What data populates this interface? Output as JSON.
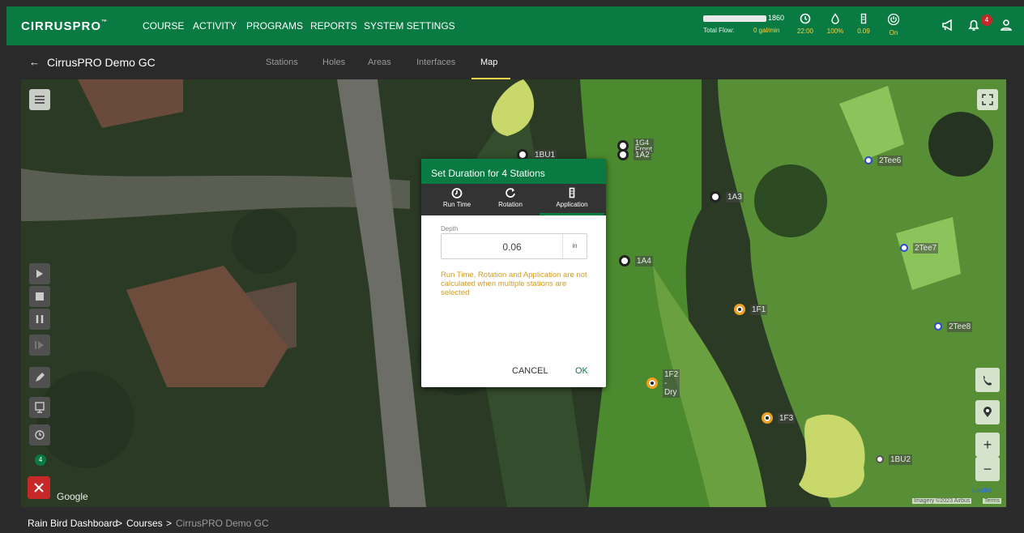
{
  "topbar": {
    "logo": "CIRRUSPRO",
    "logo_tm": "™",
    "nav": [
      "COURSE",
      "ACTIVITY",
      "PROGRAMS",
      "REPORTS",
      "SYSTEM SETTINGS"
    ],
    "flow": {
      "number": "1860",
      "label": "Total Flow:",
      "value": "0 gal/min"
    },
    "stats": [
      {
        "icon": "clock-icon",
        "value": "22:00"
      },
      {
        "icon": "water-drop-icon",
        "value": "100%"
      },
      {
        "icon": "rain-gauge-icon",
        "value": "0.09"
      },
      {
        "icon": "power-icon",
        "value": "On"
      }
    ],
    "notification_count": "4"
  },
  "subbar": {
    "back": "←",
    "title": "CirrusPRO Demo GC",
    "tabs": [
      "Stations",
      "Holes",
      "Areas",
      "Interfaces",
      "Map"
    ],
    "active_tab": "Map"
  },
  "map": {
    "selected_count": "4",
    "zoom_in": "+",
    "zoom_out": "−",
    "google": "Google",
    "leaflet": "Leaflet",
    "imagery": "Imagery ©2023 Airbus",
    "terms": "Terms",
    "stations": [
      "1BU1",
      "1G4",
      "Front",
      "1A2",
      "1A3",
      "1A4",
      "1F1",
      "1F2",
      "-",
      "Dry",
      "1F3",
      "2Tee6",
      "2Tee7",
      "2Tee8",
      "1BU2"
    ]
  },
  "dialog": {
    "title": "Set Duration for 4 Stations",
    "tabs": [
      "Run Time",
      "Rotation",
      "Application"
    ],
    "active_tab": "Application",
    "field_label": "Depth",
    "field_value": "0.06",
    "field_unit": "in",
    "note": "Run Time, Rotation and Application are not calculated when multiple stations are selected",
    "cancel": "CANCEL",
    "ok": "OK"
  },
  "footer": {
    "crumbs": [
      "Rain Bird Dashboard",
      "Courses",
      "CirrusPRO Demo GC"
    ],
    "sep": ">"
  },
  "colors": {
    "primary": "#0a7a43",
    "accent": "#f6d34a",
    "warning": "#d79b1c",
    "danger": "#c62828"
  }
}
